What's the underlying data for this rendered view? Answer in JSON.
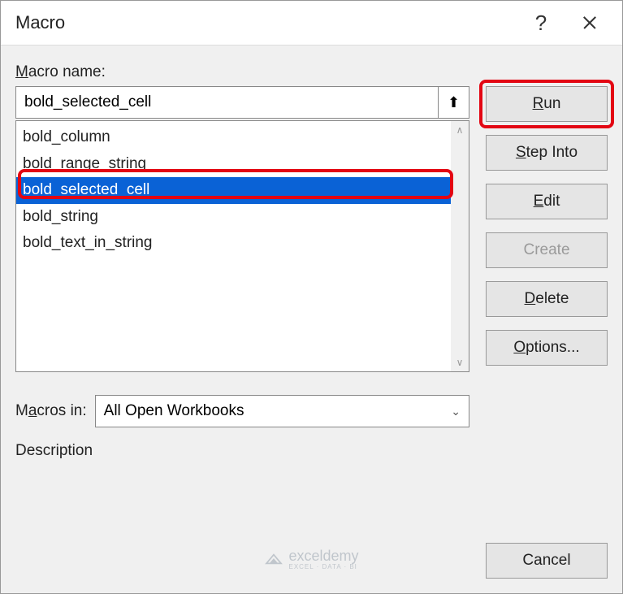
{
  "dialog": {
    "title": "Macro",
    "help": "?",
    "close": "×"
  },
  "labels": {
    "macro_name": "Macro name:",
    "macros_in": "Macros in:",
    "description": "Description"
  },
  "macro_name_value": "bold_selected_cell",
  "macros_list": {
    "items": [
      "bold_column",
      "bold_range_string",
      "bold_selected_cell",
      "bold_string",
      "bold_text_in_string"
    ],
    "selected_index": 2
  },
  "macros_in_value": "All Open Workbooks",
  "buttons": {
    "run": "Run",
    "step_into": "Step Into",
    "edit": "Edit",
    "create": "Create",
    "delete": "Delete",
    "options": "Options...",
    "cancel": "Cancel"
  },
  "icons": {
    "ref": "⬆",
    "scroll_up": "∧",
    "scroll_down": "∨",
    "chevron_down": "⌄"
  },
  "watermark": {
    "brand": "exceldemy",
    "tagline": "EXCEL · DATA · BI"
  },
  "highlights": {
    "run_button": true,
    "selected_item": true
  }
}
